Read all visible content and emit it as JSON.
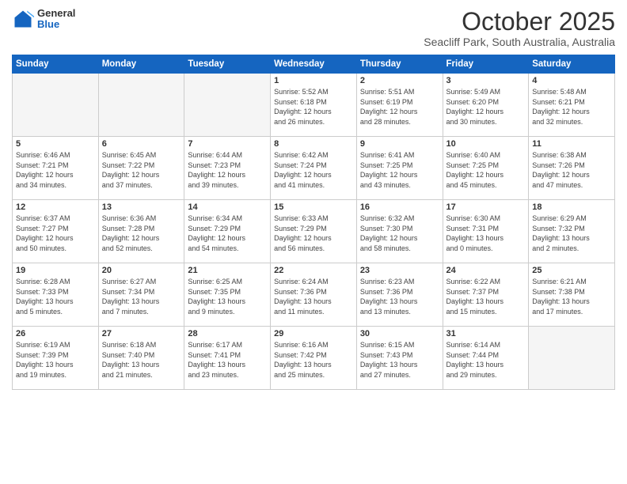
{
  "header": {
    "logo_general": "General",
    "logo_blue": "Blue",
    "main_title": "October 2025",
    "subtitle": "Seacliff Park, South Australia, Australia"
  },
  "days_of_week": [
    "Sunday",
    "Monday",
    "Tuesday",
    "Wednesday",
    "Thursday",
    "Friday",
    "Saturday"
  ],
  "weeks": [
    [
      {
        "day": "",
        "info": ""
      },
      {
        "day": "",
        "info": ""
      },
      {
        "day": "",
        "info": ""
      },
      {
        "day": "1",
        "info": "Sunrise: 5:52 AM\nSunset: 6:18 PM\nDaylight: 12 hours\nand 26 minutes."
      },
      {
        "day": "2",
        "info": "Sunrise: 5:51 AM\nSunset: 6:19 PM\nDaylight: 12 hours\nand 28 minutes."
      },
      {
        "day": "3",
        "info": "Sunrise: 5:49 AM\nSunset: 6:20 PM\nDaylight: 12 hours\nand 30 minutes."
      },
      {
        "day": "4",
        "info": "Sunrise: 5:48 AM\nSunset: 6:21 PM\nDaylight: 12 hours\nand 32 minutes."
      }
    ],
    [
      {
        "day": "5",
        "info": "Sunrise: 6:46 AM\nSunset: 7:21 PM\nDaylight: 12 hours\nand 34 minutes."
      },
      {
        "day": "6",
        "info": "Sunrise: 6:45 AM\nSunset: 7:22 PM\nDaylight: 12 hours\nand 37 minutes."
      },
      {
        "day": "7",
        "info": "Sunrise: 6:44 AM\nSunset: 7:23 PM\nDaylight: 12 hours\nand 39 minutes."
      },
      {
        "day": "8",
        "info": "Sunrise: 6:42 AM\nSunset: 7:24 PM\nDaylight: 12 hours\nand 41 minutes."
      },
      {
        "day": "9",
        "info": "Sunrise: 6:41 AM\nSunset: 7:25 PM\nDaylight: 12 hours\nand 43 minutes."
      },
      {
        "day": "10",
        "info": "Sunrise: 6:40 AM\nSunset: 7:25 PM\nDaylight: 12 hours\nand 45 minutes."
      },
      {
        "day": "11",
        "info": "Sunrise: 6:38 AM\nSunset: 7:26 PM\nDaylight: 12 hours\nand 47 minutes."
      }
    ],
    [
      {
        "day": "12",
        "info": "Sunrise: 6:37 AM\nSunset: 7:27 PM\nDaylight: 12 hours\nand 50 minutes."
      },
      {
        "day": "13",
        "info": "Sunrise: 6:36 AM\nSunset: 7:28 PM\nDaylight: 12 hours\nand 52 minutes."
      },
      {
        "day": "14",
        "info": "Sunrise: 6:34 AM\nSunset: 7:29 PM\nDaylight: 12 hours\nand 54 minutes."
      },
      {
        "day": "15",
        "info": "Sunrise: 6:33 AM\nSunset: 7:29 PM\nDaylight: 12 hours\nand 56 minutes."
      },
      {
        "day": "16",
        "info": "Sunrise: 6:32 AM\nSunset: 7:30 PM\nDaylight: 12 hours\nand 58 minutes."
      },
      {
        "day": "17",
        "info": "Sunrise: 6:30 AM\nSunset: 7:31 PM\nDaylight: 13 hours\nand 0 minutes."
      },
      {
        "day": "18",
        "info": "Sunrise: 6:29 AM\nSunset: 7:32 PM\nDaylight: 13 hours\nand 2 minutes."
      }
    ],
    [
      {
        "day": "19",
        "info": "Sunrise: 6:28 AM\nSunset: 7:33 PM\nDaylight: 13 hours\nand 5 minutes."
      },
      {
        "day": "20",
        "info": "Sunrise: 6:27 AM\nSunset: 7:34 PM\nDaylight: 13 hours\nand 7 minutes."
      },
      {
        "day": "21",
        "info": "Sunrise: 6:25 AM\nSunset: 7:35 PM\nDaylight: 13 hours\nand 9 minutes."
      },
      {
        "day": "22",
        "info": "Sunrise: 6:24 AM\nSunset: 7:36 PM\nDaylight: 13 hours\nand 11 minutes."
      },
      {
        "day": "23",
        "info": "Sunrise: 6:23 AM\nSunset: 7:36 PM\nDaylight: 13 hours\nand 13 minutes."
      },
      {
        "day": "24",
        "info": "Sunrise: 6:22 AM\nSunset: 7:37 PM\nDaylight: 13 hours\nand 15 minutes."
      },
      {
        "day": "25",
        "info": "Sunrise: 6:21 AM\nSunset: 7:38 PM\nDaylight: 13 hours\nand 17 minutes."
      }
    ],
    [
      {
        "day": "26",
        "info": "Sunrise: 6:19 AM\nSunset: 7:39 PM\nDaylight: 13 hours\nand 19 minutes."
      },
      {
        "day": "27",
        "info": "Sunrise: 6:18 AM\nSunset: 7:40 PM\nDaylight: 13 hours\nand 21 minutes."
      },
      {
        "day": "28",
        "info": "Sunrise: 6:17 AM\nSunset: 7:41 PM\nDaylight: 13 hours\nand 23 minutes."
      },
      {
        "day": "29",
        "info": "Sunrise: 6:16 AM\nSunset: 7:42 PM\nDaylight: 13 hours\nand 25 minutes."
      },
      {
        "day": "30",
        "info": "Sunrise: 6:15 AM\nSunset: 7:43 PM\nDaylight: 13 hours\nand 27 minutes."
      },
      {
        "day": "31",
        "info": "Sunrise: 6:14 AM\nSunset: 7:44 PM\nDaylight: 13 hours\nand 29 minutes."
      },
      {
        "day": "",
        "info": ""
      }
    ]
  ]
}
